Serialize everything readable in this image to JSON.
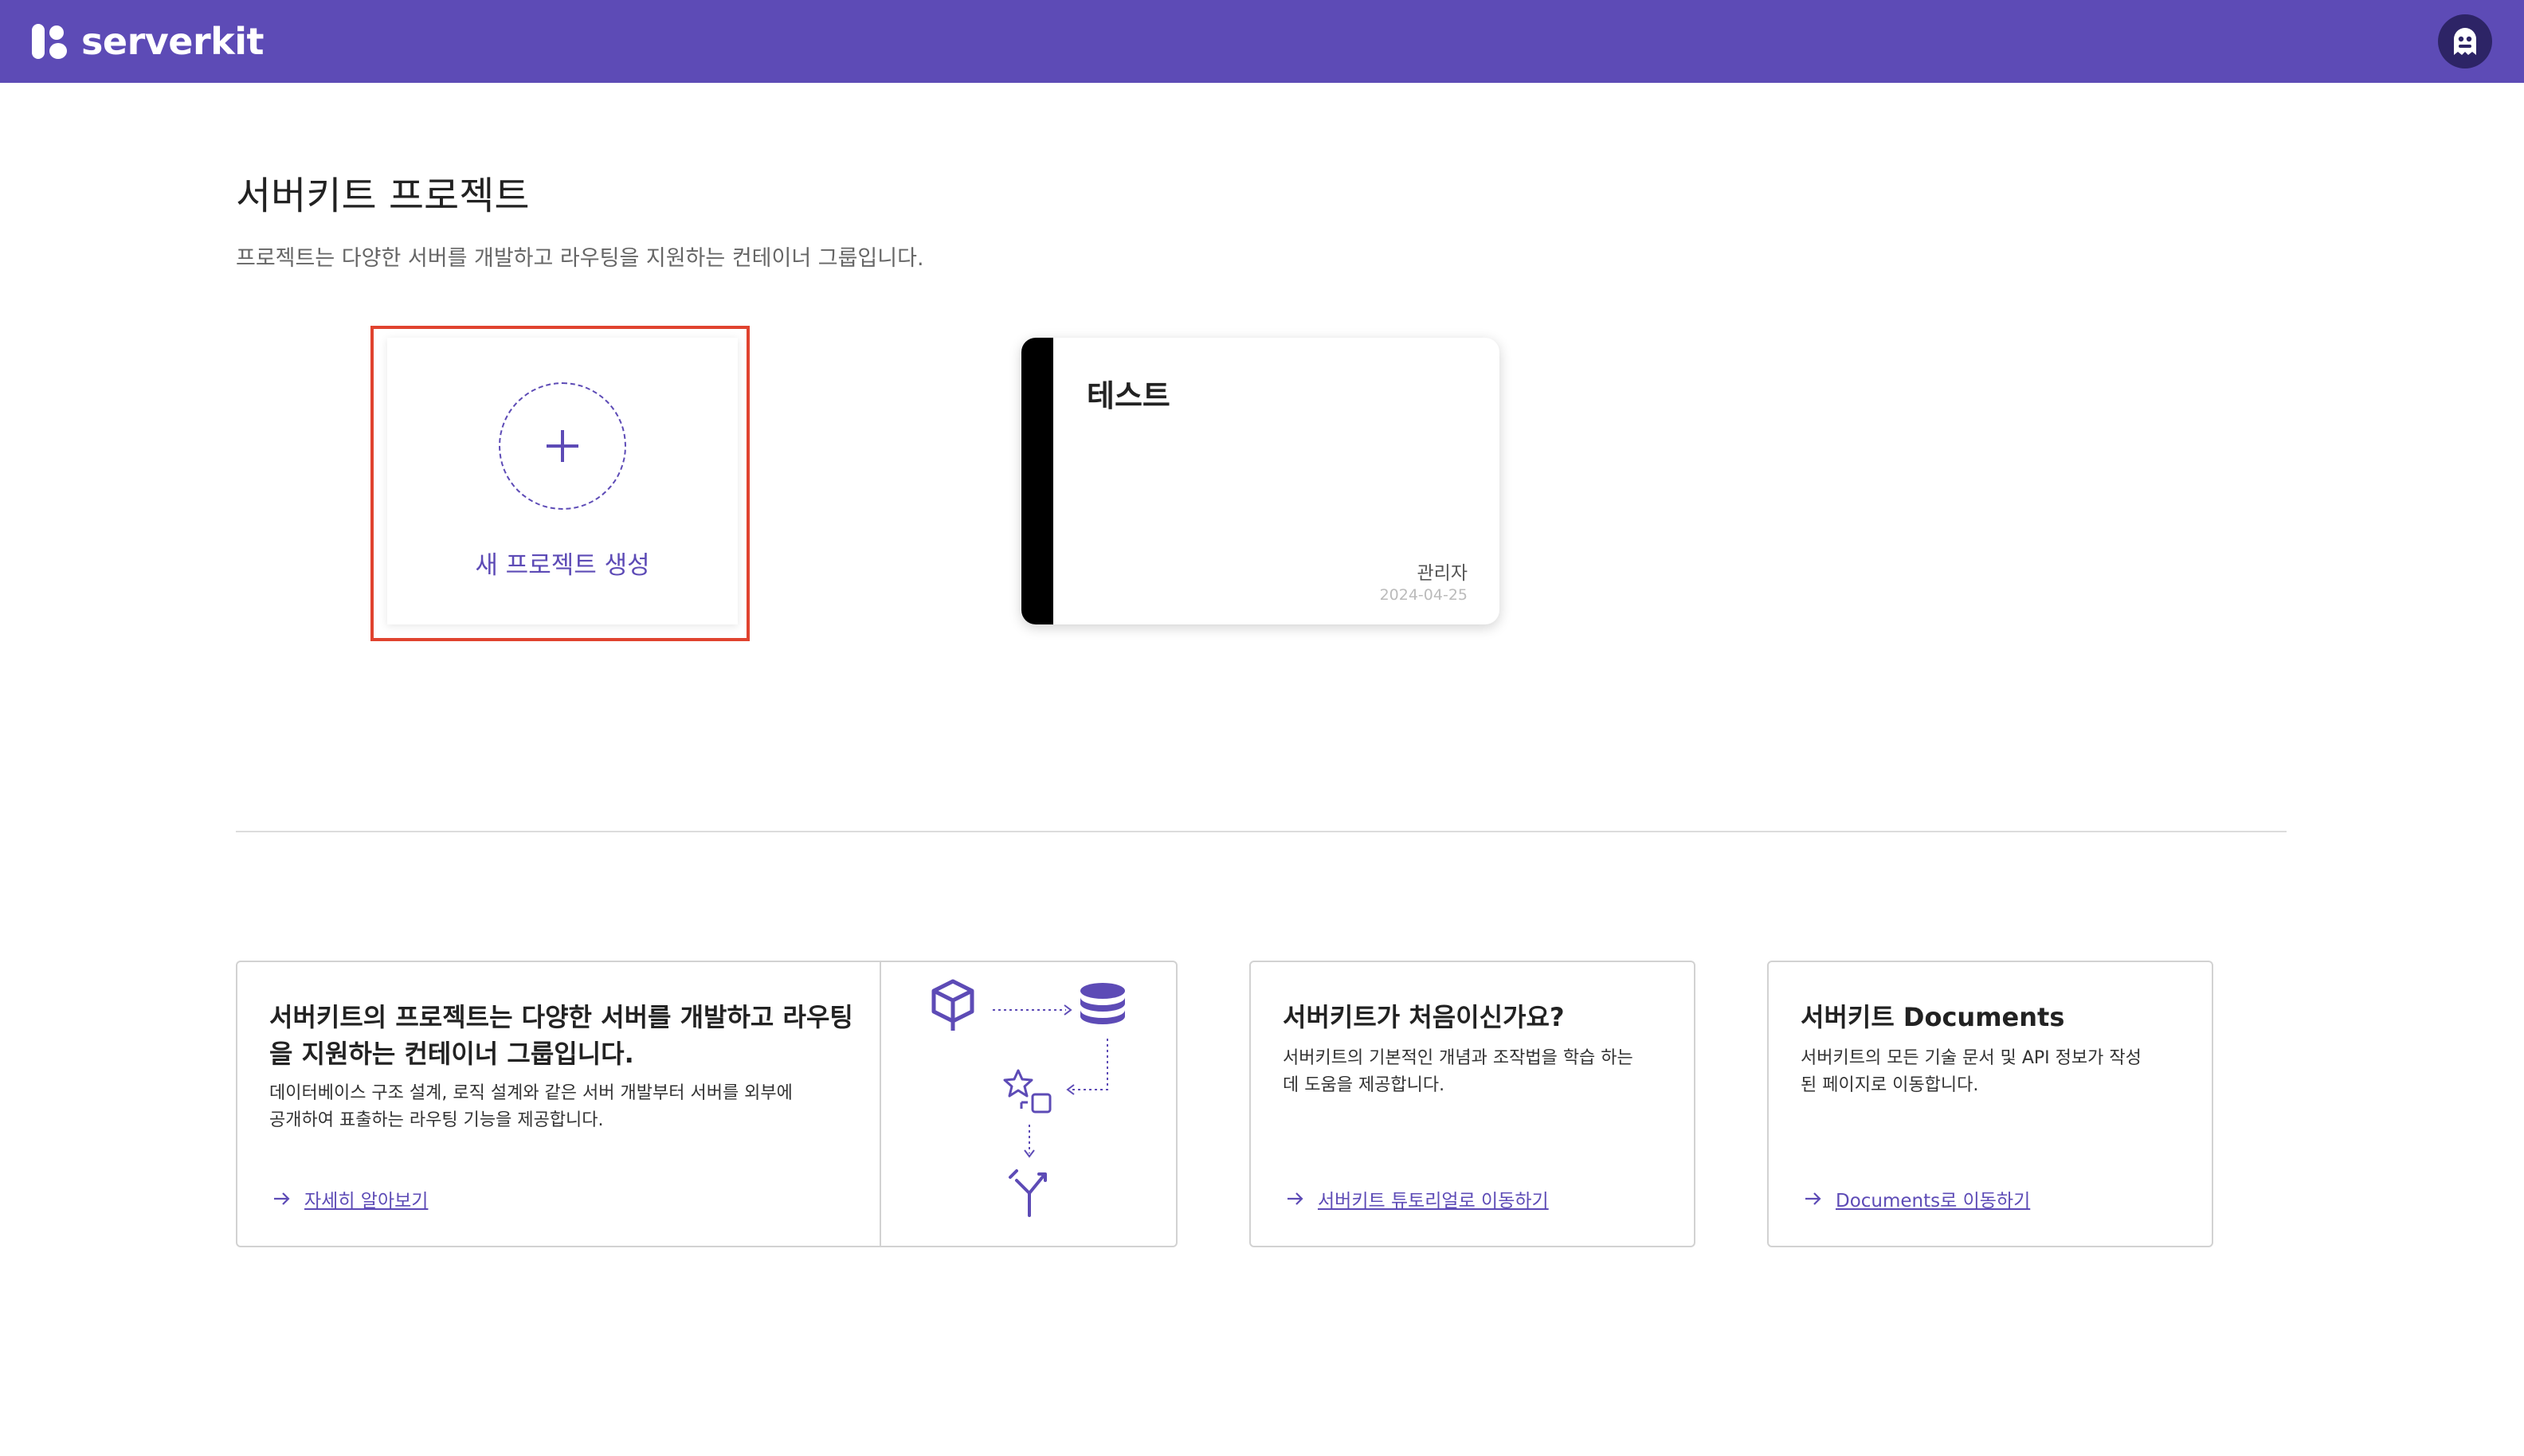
{
  "header": {
    "brand": "serverkit",
    "logo_icon": "serverkit-logo-icon",
    "avatar_icon": "ghost-avatar-icon",
    "accent_color": "#5d4bb6"
  },
  "main": {
    "title": "서버키트 프로젝트",
    "description": "프로젝트는 다양한 서버를 개발하고 라우팅을 지원하는 컨테이너 그룹입니다.",
    "new_project": {
      "label": "새 프로젝트 생성",
      "icon": "plus-icon"
    },
    "projects": [
      {
        "name": "테스트",
        "owner": "관리자",
        "date": "2024-04-25",
        "color": "#000000"
      }
    ]
  },
  "info_cards": {
    "main": {
      "title_line1": "서버키트의 프로젝트는 다양한 서버를 개발하고 라우팅",
      "title_line2": "을 지원하는 컨테이너 그룹입니다.",
      "text_line1": "데이터베이스 구조 설계, 로직 설계와 같은 서버 개발부터 서버를 외부에",
      "text_line2": "공개하여 표출하는 라우팅 기능을 제공합니다.",
      "link": "자세히 알아보기",
      "illustration_icons": [
        "cube-icon",
        "database-icon",
        "shapes-icon",
        "route-split-icon"
      ]
    },
    "tutorial": {
      "title": "서버키트가 처음이신가요?",
      "text_line1": "서버키트의 기본적인 개념과 조작법을 학습 하는",
      "text_line2": "데 도움을 제공합니다.",
      "link": "서버키트 튜토리얼로 이동하기"
    },
    "docs": {
      "title": "서버키트 Documents",
      "text_line1": "서버키트의 모든 기술 문서 및 API 정보가 작성",
      "text_line2": "된 페이지로 이동합니다.",
      "link": "Documents로 이동하기"
    }
  }
}
